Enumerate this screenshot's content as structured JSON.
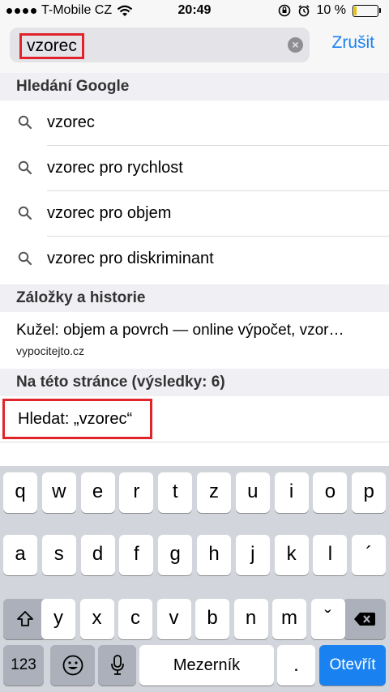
{
  "status_bar": {
    "carrier": "T-Mobile CZ",
    "time": "20:49",
    "battery_percent": "10 %",
    "battery_level": 0.1
  },
  "search": {
    "query": "vzorec",
    "cancel_label": "Zrušit"
  },
  "google_section": {
    "title": "Hledání Google",
    "suggestions": [
      "vzorec",
      "vzorec pro rychlost",
      "vzorec pro objem",
      "vzorec pro diskriminant"
    ]
  },
  "history_section": {
    "title": "Záložky a historie",
    "item_title": "Kužel: objem a povrch — online výpočet, vzor…",
    "item_url": "vypocitejto.cz"
  },
  "page_section": {
    "title": "Na této stránce (výsledky: 6)",
    "find_label": "Hledat: „vzorec“"
  },
  "keyboard": {
    "row1": [
      "q",
      "w",
      "e",
      "r",
      "t",
      "z",
      "u",
      "i",
      "o",
      "p"
    ],
    "row2": [
      "a",
      "s",
      "d",
      "f",
      "g",
      "h",
      "j",
      "k",
      "l",
      "´"
    ],
    "row3": [
      "y",
      "x",
      "c",
      "v",
      "b",
      "n",
      "m",
      "ˇ"
    ],
    "numbers_label": "123",
    "space_label": "Mezerník",
    "dot_label": ".",
    "go_label": "Otevřít"
  },
  "colors": {
    "accent": "#1a82f0",
    "highlight": "#e1232a"
  }
}
